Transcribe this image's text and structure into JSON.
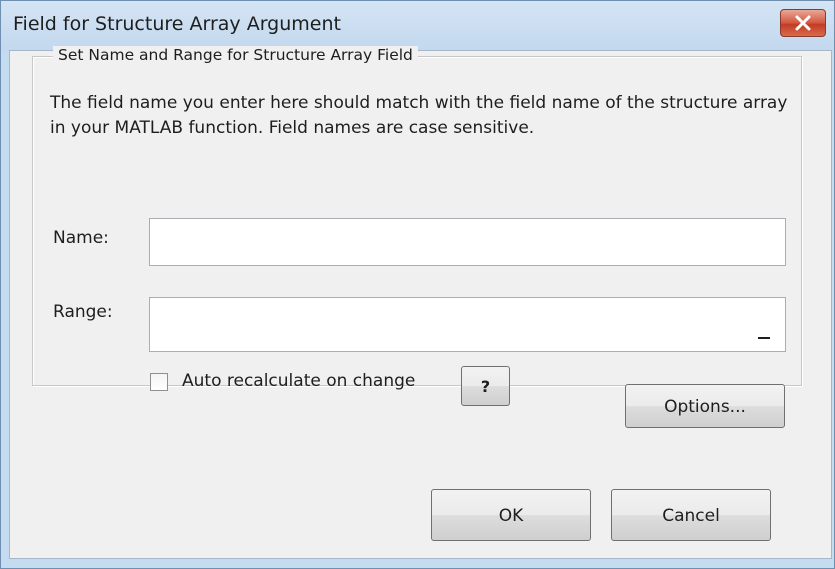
{
  "window": {
    "title": "Field for Structure Array Argument"
  },
  "group": {
    "legend": "Set Name and Range for Structure Array Field",
    "description": "The field name you enter here should match with the field name of the structure array in your MATLAB function. Field names are case sensitive."
  },
  "fields": {
    "name_label": "Name:",
    "name_value": "",
    "range_label": "Range:",
    "range_value": "",
    "range_button_label": "_"
  },
  "auto_recalc": {
    "label": "Auto recalculate on change",
    "checked": false
  },
  "buttons": {
    "help": "?",
    "options": "Options...",
    "ok": "OK",
    "cancel": "Cancel"
  },
  "colors": {
    "titlebar": "#c5dbef",
    "close_button": "#c9442c",
    "dialog_background": "#f0f0f0"
  },
  "icons": {
    "close": "close-icon"
  }
}
